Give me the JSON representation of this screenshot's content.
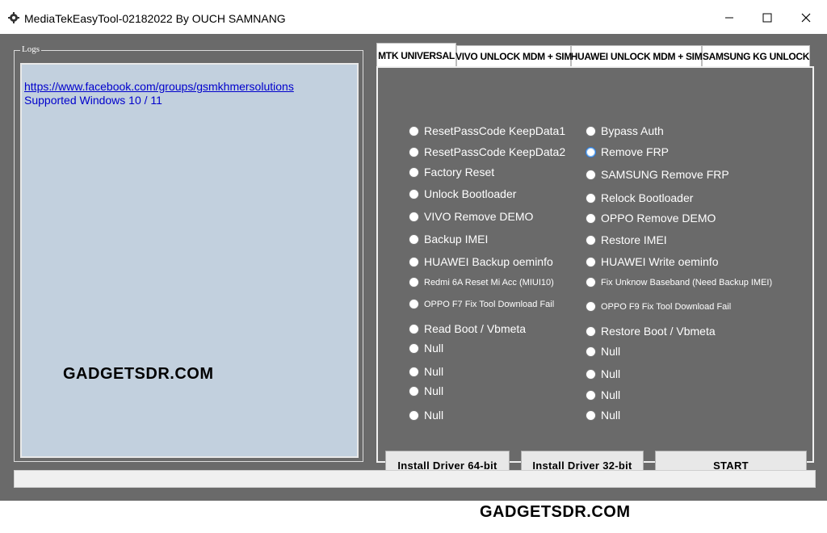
{
  "window": {
    "title": "MediaTekEasyTool-02182022 By OUCH SAMNANG"
  },
  "logs": {
    "legend": "Logs",
    "link": "https://www.facebook.com/groups/gsmkhmersolutions",
    "line2": "Supported Windows 10 / 11"
  },
  "watermark": "GADGETSDR.COM",
  "tabs": [
    {
      "label": "MTK UNIVERSAL",
      "active": true
    },
    {
      "label": "VIVO UNLOCK MDM + SIM",
      "active": false
    },
    {
      "label": "HUAWEI UNLOCK MDM + SIM",
      "active": false
    },
    {
      "label": "SAMSUNG KG UNLOCK",
      "active": false
    }
  ],
  "options_left": [
    "ResetPassCode KeepData1",
    "ResetPassCode KeepData2",
    "Factory Reset",
    "Unlock Bootloader",
    "VIVO Remove DEMO",
    "Backup IMEI",
    "HUAWEI Backup oeminfo",
    "Redmi 6A Reset Mi Acc (MIUI10)",
    "OPPO F7 Fix Tool Download Fail",
    "Read Boot / Vbmeta",
    "Null",
    "Null",
    "Null",
    "Null"
  ],
  "options_right": [
    "Bypass Auth",
    "Remove FRP",
    "SAMSUNG Remove FRP",
    "Relock Bootloader",
    "OPPO Remove DEMO",
    "Restore IMEI",
    "HUAWEI Write oeminfo",
    "Fix Unknow Baseband (Need Backup IMEI)",
    "OPPO F9 Fix Tool Download Fail",
    "Restore Boot / Vbmeta",
    "Null",
    "Null",
    "Null",
    "Null"
  ],
  "selected_option": "Remove FRP",
  "buttons": {
    "driver64": "Install Driver 64-bit",
    "driver32": "Install Driver 32-bit",
    "start": "START"
  }
}
